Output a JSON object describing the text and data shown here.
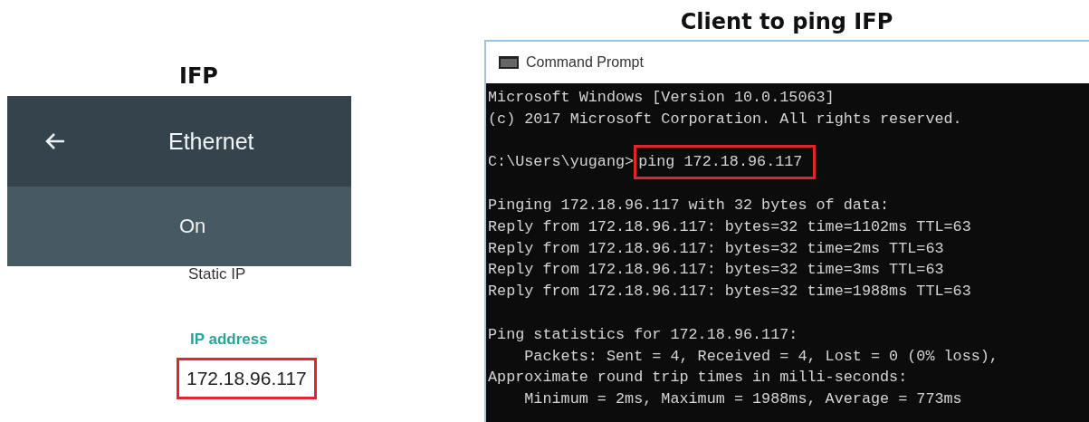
{
  "ifp": {
    "heading": "IFP",
    "app_bar": {
      "title": "Ethernet"
    },
    "status": "On",
    "static_ip_label": "Static IP",
    "ip_label": "IP address",
    "ip_value": "172.18.96.117",
    "ip_highlighted": true
  },
  "client": {
    "heading": "Client to ping IFP",
    "window": {
      "title": "Command Prompt"
    },
    "lines": [
      {
        "kind": "text",
        "text": "Microsoft Windows [Version 10.0.15063]"
      },
      {
        "kind": "text",
        "text": "(c) 2017 Microsoft Corporation. All rights reserved."
      },
      {
        "kind": "blank"
      },
      {
        "kind": "prompt",
        "prompt": "C:\\Users\\yugang>",
        "command": "ping 172.18.96.117",
        "highlighted": true
      },
      {
        "kind": "blank"
      },
      {
        "kind": "text",
        "text": "Pinging 172.18.96.117 with 32 bytes of data:"
      },
      {
        "kind": "text",
        "text": "Reply from 172.18.96.117: bytes=32 time=1102ms TTL=63"
      },
      {
        "kind": "text",
        "text": "Reply from 172.18.96.117: bytes=32 time=2ms TTL=63"
      },
      {
        "kind": "text",
        "text": "Reply from 172.18.96.117: bytes=32 time=3ms TTL=63"
      },
      {
        "kind": "text",
        "text": "Reply from 172.18.96.117: bytes=32 time=1988ms TTL=63"
      },
      {
        "kind": "blank"
      },
      {
        "kind": "text",
        "text": "Ping statistics for 172.18.96.117:"
      },
      {
        "kind": "text",
        "text": "    Packets: Sent = 4, Received = 4, Lost = 0 (0% loss),"
      },
      {
        "kind": "text",
        "text": "Approximate round trip times in milli-seconds:"
      },
      {
        "kind": "text",
        "text": "    Minimum = 2ms, Maximum = 1988ms, Average = 773ms"
      }
    ]
  }
}
